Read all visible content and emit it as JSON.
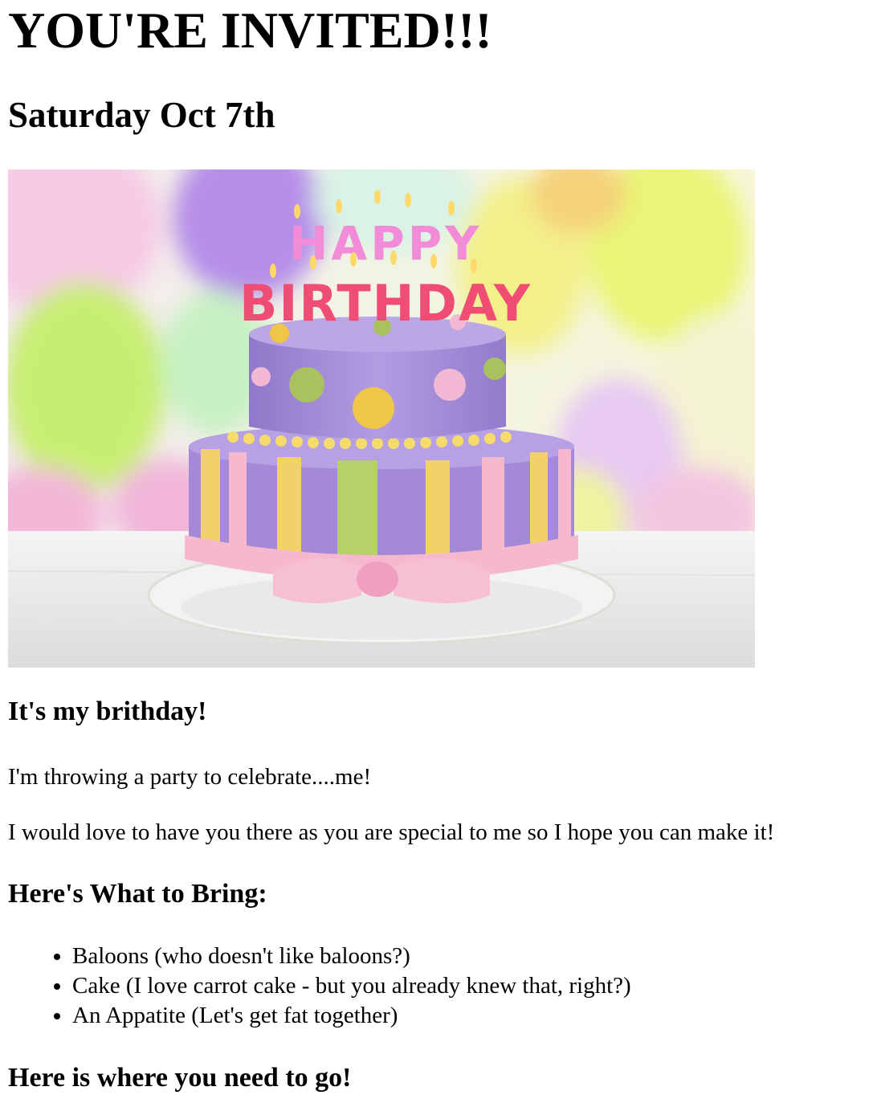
{
  "invite": {
    "title": "YOU'RE INVITED!!!",
    "date": "Saturday Oct 7th",
    "image_text_line1": "HAPPY",
    "image_text_line2": "BIRTHDAY"
  },
  "intro": {
    "heading": "It's my brithday!",
    "paragraph1": "I'm throwing a party to celebrate....me!",
    "paragraph2": "I would love to have you there as you are special to me so I hope you can make it!"
  },
  "bring": {
    "heading": "Here's What to Bring:",
    "items": [
      "Baloons (who doesn't like baloons?)",
      "Cake (I love carrot cake - but you already knew that, right?)",
      "An Appatite (Let's get fat together)"
    ]
  },
  "location": {
    "heading": "Here is where you need to go!"
  },
  "colors": {
    "text": "#000000",
    "background": "#ffffff",
    "cake_purple": "#a48ad6",
    "ribbon_pink": "#f6b8cf",
    "stripe_yellow": "#f3d16a",
    "stripe_green": "#b8d06a"
  }
}
